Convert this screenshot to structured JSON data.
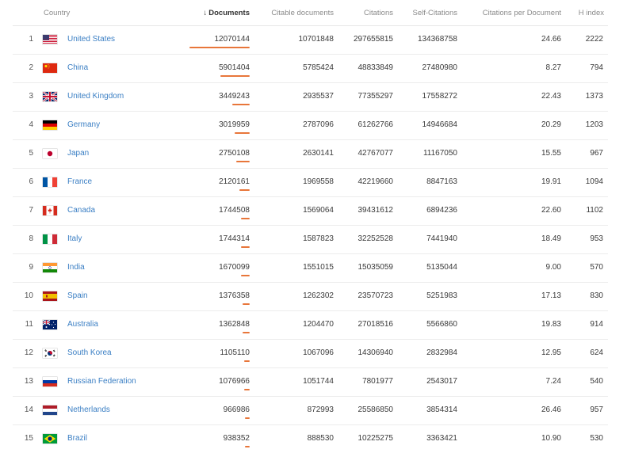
{
  "header": {
    "country": "Country",
    "documents": "Documents",
    "citable": "Citable documents",
    "citations": "Citations",
    "self_citations": "Self-Citations",
    "cpd": "Citations per Document",
    "h_index": "H index",
    "sort_arrow": "↓"
  },
  "bar_color": "#e8763a",
  "rows": [
    {
      "rank": "1",
      "country": "United States",
      "documents": "12070144",
      "citable": "10701848",
      "citations": "297655815",
      "self": "134368758",
      "cpd": "24.66",
      "h": "2222",
      "flag": "us",
      "doc_value": 12070144
    },
    {
      "rank": "2",
      "country": "China",
      "documents": "5901404",
      "citable": "5785424",
      "citations": "48833849",
      "self": "27480980",
      "cpd": "8.27",
      "h": "794",
      "flag": "cn",
      "doc_value": 5901404
    },
    {
      "rank": "3",
      "country": "United Kingdom",
      "documents": "3449243",
      "citable": "2935537",
      "citations": "77355297",
      "self": "17558272",
      "cpd": "22.43",
      "h": "1373",
      "flag": "gb",
      "doc_value": 3449243
    },
    {
      "rank": "4",
      "country": "Germany",
      "documents": "3019959",
      "citable": "2787096",
      "citations": "61262766",
      "self": "14946684",
      "cpd": "20.29",
      "h": "1203",
      "flag": "de",
      "doc_value": 3019959
    },
    {
      "rank": "5",
      "country": "Japan",
      "documents": "2750108",
      "citable": "2630141",
      "citations": "42767077",
      "self": "11167050",
      "cpd": "15.55",
      "h": "967",
      "flag": "jp",
      "doc_value": 2750108
    },
    {
      "rank": "6",
      "country": "France",
      "documents": "2120161",
      "citable": "1969558",
      "citations": "42219660",
      "self": "8847163",
      "cpd": "19.91",
      "h": "1094",
      "flag": "fr",
      "doc_value": 2120161
    },
    {
      "rank": "7",
      "country": "Canada",
      "documents": "1744508",
      "citable": "1569064",
      "citations": "39431612",
      "self": "6894236",
      "cpd": "22.60",
      "h": "1102",
      "flag": "ca",
      "doc_value": 1744508
    },
    {
      "rank": "8",
      "country": "Italy",
      "documents": "1744314",
      "citable": "1587823",
      "citations": "32252528",
      "self": "7441940",
      "cpd": "18.49",
      "h": "953",
      "flag": "it",
      "doc_value": 1744314
    },
    {
      "rank": "9",
      "country": "India",
      "documents": "1670099",
      "citable": "1551015",
      "citations": "15035059",
      "self": "5135044",
      "cpd": "9.00",
      "h": "570",
      "flag": "in",
      "doc_value": 1670099
    },
    {
      "rank": "10",
      "country": "Spain",
      "documents": "1376358",
      "citable": "1262302",
      "citations": "23570723",
      "self": "5251983",
      "cpd": "17.13",
      "h": "830",
      "flag": "es",
      "doc_value": 1376358
    },
    {
      "rank": "11",
      "country": "Australia",
      "documents": "1362848",
      "citable": "1204470",
      "citations": "27018516",
      "self": "5566860",
      "cpd": "19.83",
      "h": "914",
      "flag": "au",
      "doc_value": 1362848
    },
    {
      "rank": "12",
      "country": "South Korea",
      "documents": "1105110",
      "citable": "1067096",
      "citations": "14306940",
      "self": "2832984",
      "cpd": "12.95",
      "h": "624",
      "flag": "kr",
      "doc_value": 1105110
    },
    {
      "rank": "13",
      "country": "Russian Federation",
      "documents": "1076966",
      "citable": "1051744",
      "citations": "7801977",
      "self": "2543017",
      "cpd": "7.24",
      "h": "540",
      "flag": "ru",
      "doc_value": 1076966
    },
    {
      "rank": "14",
      "country": "Netherlands",
      "documents": "966986",
      "citable": "872993",
      "citations": "25586850",
      "self": "3854314",
      "cpd": "26.46",
      "h": "957",
      "flag": "nl",
      "doc_value": 966986
    },
    {
      "rank": "15",
      "country": "Brazil",
      "documents": "938352",
      "citable": "888530",
      "citations": "10225275",
      "self": "3363421",
      "cpd": "10.90",
      "h": "530",
      "flag": "br",
      "doc_value": 938352
    }
  ]
}
